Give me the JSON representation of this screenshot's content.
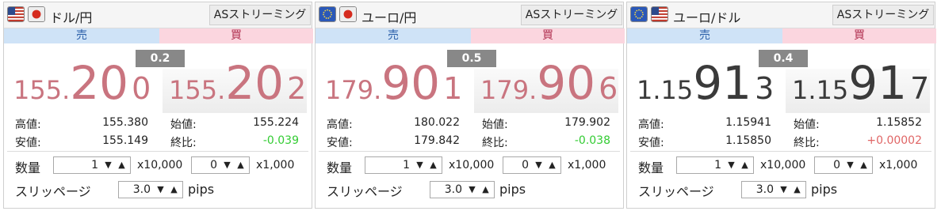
{
  "common": {
    "as_streaming_label": "ASストリーミング",
    "sell_label": "売",
    "buy_label": "買",
    "high_label": "高値:",
    "low_label": "安値:",
    "open_label": "始値:",
    "change_label": "終比:",
    "quantity_label": "数量",
    "slippage_label": "スリッページ",
    "mult_10000": "x10,000",
    "mult_1000": "x1,000",
    "pips_label": "pips",
    "up_arrow": "▲",
    "down_arrow": "▼"
  },
  "colors": {
    "price_red": "#c9747f",
    "price_dark": "#3a3a3a",
    "change_green": "#33cc33",
    "change_red": "#e06666",
    "sell_header_bg": "#cfe3f7",
    "buy_header_bg": "#fbd6df"
  },
  "panels": [
    {
      "flags": [
        "us-flag-icon",
        "jp-flag-icon"
      ],
      "pair": "ドル/円",
      "spread": "0.2",
      "sell": {
        "small": "155.",
        "big": "20",
        "last": "0"
      },
      "buy": {
        "small": "155.",
        "big": "20",
        "last": "2"
      },
      "high": "155.380",
      "low": "155.149",
      "open": "155.224",
      "change": "-0.039",
      "change_color": "#33cc33",
      "price_color": "#c9747f",
      "qty_10000": "1",
      "qty_1000": "0",
      "slippage": "3.0"
    },
    {
      "flags": [
        "eu-flag-icon",
        "jp-flag-icon"
      ],
      "pair": "ユーロ/円",
      "spread": "0.5",
      "sell": {
        "small": "179.",
        "big": "90",
        "last": "1"
      },
      "buy": {
        "small": "179.",
        "big": "90",
        "last": "6"
      },
      "high": "180.022",
      "low": "179.842",
      "open": "179.902",
      "change": "-0.038",
      "change_color": "#33cc33",
      "price_color": "#c9747f",
      "qty_10000": "1",
      "qty_1000": "0",
      "slippage": "3.0"
    },
    {
      "flags": [
        "eu-flag-icon",
        "us-flag-icon"
      ],
      "pair": "ユーロ/ドル",
      "spread": "0.4",
      "sell": {
        "small": "1.15",
        "big": "91",
        "last": "3"
      },
      "buy": {
        "small": "1.15",
        "big": "91",
        "last": "7"
      },
      "high": "1.15941",
      "low": "1.15850",
      "open": "1.15852",
      "change": "+0.00002",
      "change_color": "#e06666",
      "price_color": "#3a3a3a",
      "qty_10000": "1",
      "qty_1000": "0",
      "slippage": "3.0"
    }
  ]
}
